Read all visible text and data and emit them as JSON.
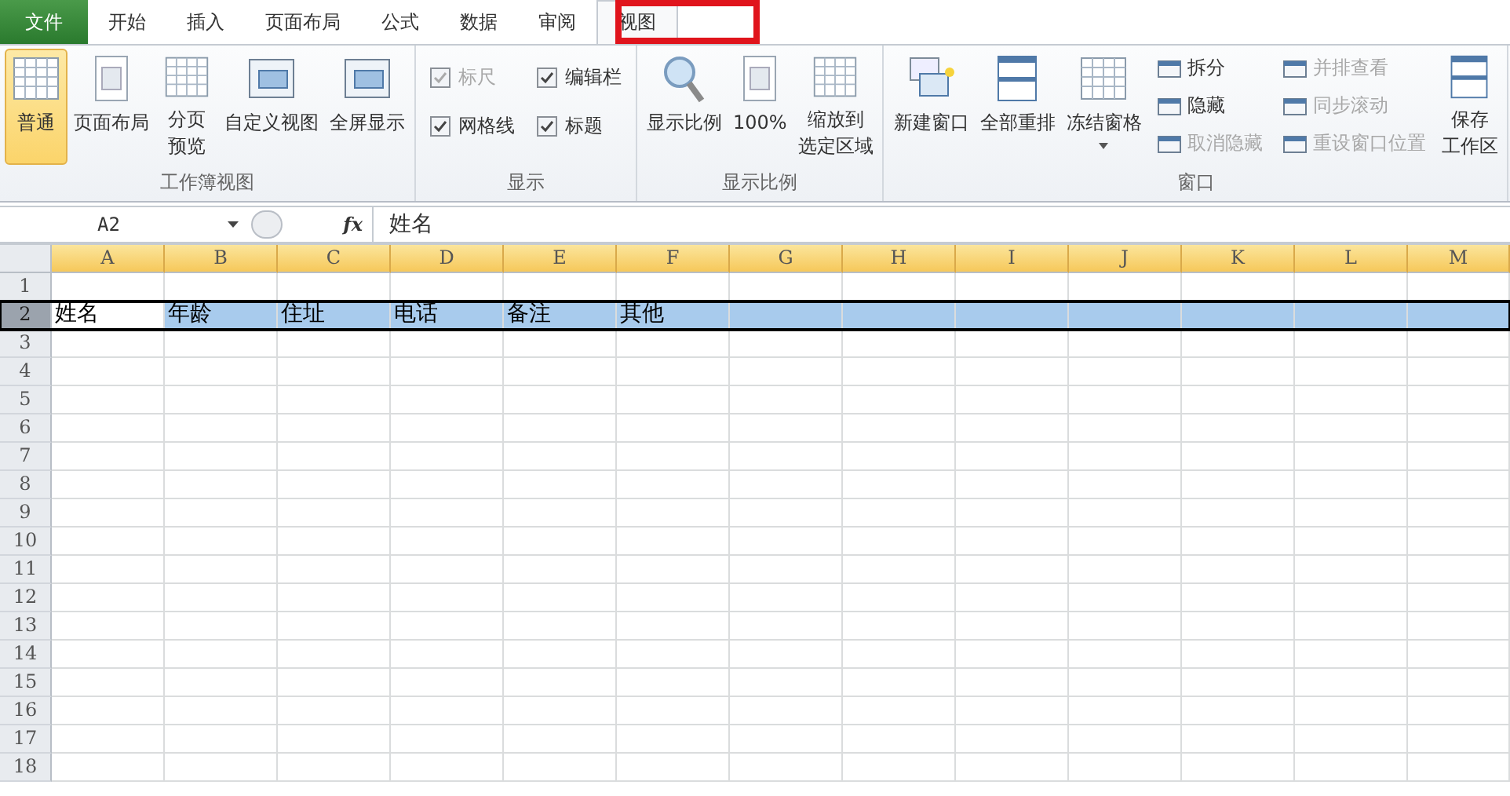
{
  "tabs": [
    {
      "label": "文件",
      "kind": "file",
      "selected": false
    },
    {
      "label": "开始",
      "kind": "tab",
      "selected": false
    },
    {
      "label": "插入",
      "kind": "tab",
      "selected": false
    },
    {
      "label": "页面布局",
      "kind": "tab",
      "selected": false
    },
    {
      "label": "公式",
      "kind": "tab",
      "selected": false
    },
    {
      "label": "数据",
      "kind": "tab",
      "selected": false
    },
    {
      "label": "审阅",
      "kind": "tab",
      "selected": false
    },
    {
      "label": "视图",
      "kind": "tab",
      "selected": true
    }
  ],
  "ribbon": {
    "groups": [
      {
        "label": "工作簿视图",
        "items": [
          {
            "kind": "large",
            "label": "普通",
            "selected": true
          },
          {
            "kind": "large",
            "label": "页面布局",
            "selected": false
          },
          {
            "kind": "large",
            "label_lines": [
              "分页",
              "预览"
            ],
            "selected": false
          },
          {
            "kind": "large",
            "label": "自定义视图",
            "selected": false
          },
          {
            "kind": "large",
            "label": "全屏显示",
            "selected": false
          }
        ]
      },
      {
        "label": "显示",
        "items": [
          {
            "kind": "checkbox",
            "label": "标尺",
            "checked": true,
            "disabled": true
          },
          {
            "kind": "checkbox",
            "label": "编辑栏",
            "checked": true,
            "disabled": false
          },
          {
            "kind": "checkbox",
            "label": "网格线",
            "checked": true,
            "disabled": false
          },
          {
            "kind": "checkbox",
            "label": "标题",
            "checked": true,
            "disabled": false
          }
        ]
      },
      {
        "label": "显示比例",
        "items": [
          {
            "kind": "large",
            "label": "显示比例",
            "selected": false
          },
          {
            "kind": "large",
            "label": "100%",
            "selected": false
          },
          {
            "kind": "large",
            "label_lines": [
              "缩放到",
              "选定区域"
            ],
            "selected": false
          }
        ]
      },
      {
        "label": "窗口",
        "items": [
          {
            "kind": "large",
            "label": "新建窗口",
            "selected": false
          },
          {
            "kind": "large",
            "label": "全部重排",
            "selected": false
          },
          {
            "kind": "large",
            "label": "冻结窗格",
            "selected": false,
            "dropdown": true
          },
          {
            "kind": "small",
            "label": "拆分",
            "disabled": false
          },
          {
            "kind": "small",
            "label": "隐藏",
            "disabled": false
          },
          {
            "kind": "small",
            "label": "取消隐藏",
            "disabled": true
          },
          {
            "kind": "small",
            "label": "并排查看",
            "disabled": true
          },
          {
            "kind": "small",
            "label": "同步滚动",
            "disabled": true
          },
          {
            "kind": "small",
            "label": "重设窗口位置",
            "disabled": true
          },
          {
            "kind": "large",
            "label_lines": [
              "保存",
              "工作区"
            ],
            "selected": false
          }
        ]
      }
    ]
  },
  "formula_bar": {
    "name_box": "A2",
    "fx": "fx",
    "value": "姓名"
  },
  "sheet": {
    "columns": [
      {
        "label": "A",
        "selected": true
      },
      {
        "label": "B",
        "selected": true
      },
      {
        "label": "C",
        "selected": true
      },
      {
        "label": "D",
        "selected": true
      },
      {
        "label": "E",
        "selected": true
      },
      {
        "label": "F",
        "selected": true
      },
      {
        "label": "G",
        "selected": true
      },
      {
        "label": "H",
        "selected": true
      },
      {
        "label": "I",
        "selected": true
      },
      {
        "label": "J",
        "selected": true
      },
      {
        "label": "K",
        "selected": true
      },
      {
        "label": "L",
        "selected": true
      },
      {
        "label": "M",
        "selected": true
      }
    ],
    "rows": [
      {
        "label": "1",
        "selected": false,
        "cells": []
      },
      {
        "label": "2",
        "selected": true,
        "cells": [
          "姓名",
          "年龄",
          "住址",
          "电话",
          "备注",
          "其他"
        ]
      },
      {
        "label": "3",
        "selected": false,
        "cells": []
      },
      {
        "label": "4",
        "selected": false,
        "cells": []
      },
      {
        "label": "5",
        "selected": false,
        "cells": []
      },
      {
        "label": "6",
        "selected": false,
        "cells": []
      },
      {
        "label": "7",
        "selected": false,
        "cells": []
      },
      {
        "label": "8",
        "selected": false,
        "cells": []
      },
      {
        "label": "9",
        "selected": false,
        "cells": []
      },
      {
        "label": "10",
        "selected": false,
        "cells": []
      },
      {
        "label": "11",
        "selected": false,
        "cells": []
      },
      {
        "label": "12",
        "selected": false,
        "cells": []
      },
      {
        "label": "13",
        "selected": false,
        "cells": []
      },
      {
        "label": "14",
        "selected": false,
        "cells": []
      },
      {
        "label": "15",
        "selected": false,
        "cells": []
      },
      {
        "label": "16",
        "selected": false,
        "cells": []
      },
      {
        "label": "17",
        "selected": false,
        "cells": []
      },
      {
        "label": "18",
        "selected": false,
        "cells": []
      }
    ]
  },
  "annotation": {
    "kind": "highlight"
  }
}
